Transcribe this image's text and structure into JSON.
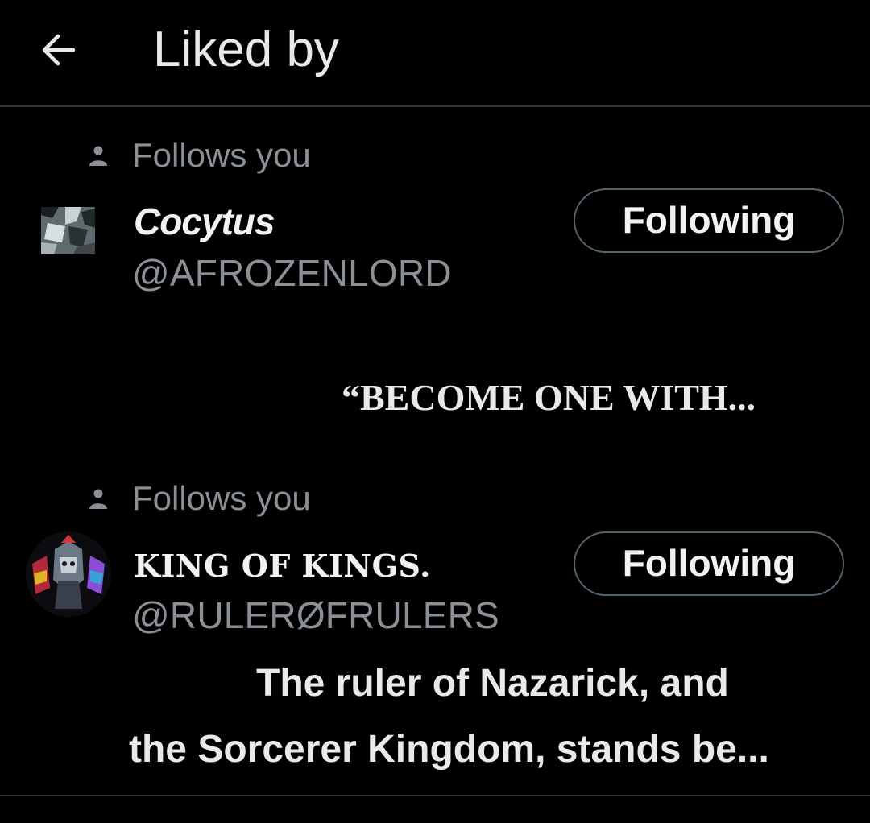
{
  "header": {
    "title": "Liked by",
    "back_icon": "arrow-left-icon"
  },
  "users": [
    {
      "social_context": "Follows you",
      "display_name": "Cocytus",
      "handle": "@AFROZENLORD",
      "follow_button": "Following",
      "bio": "“BECOME ONE WITH..."
    },
    {
      "social_context": "Follows you",
      "display_name": "KING OF KINGS.",
      "handle": "@RULERØFRULERS",
      "follow_button": "Following",
      "bio_line1": "The ruler of Nazarick, and",
      "bio_line2": "the Sorcerer Kingdom, stands be..."
    }
  ],
  "colors": {
    "background": "#000000",
    "text": "#e7e9ea",
    "muted": "#8b9096",
    "border": "#536471",
    "divider": "#2f3336"
  }
}
